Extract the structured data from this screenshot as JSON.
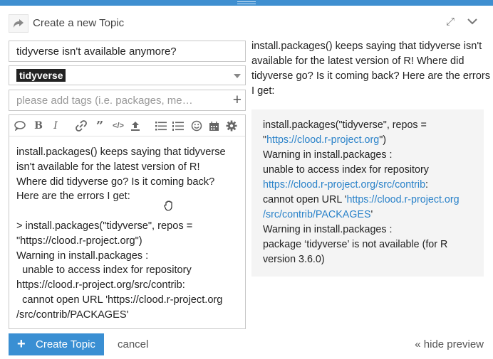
{
  "header": {
    "title": "Create a new Topic",
    "icons": [
      "reply-icon",
      "expand-icon",
      "collapse-chevron-icon"
    ]
  },
  "composer": {
    "title_value": "tidyverse isn't available anymore?",
    "category": "tidyverse",
    "tags_placeholder": "please add tags (i.e. packages, me…",
    "toolbar_icons": [
      "quote-icon",
      "bold-icon",
      "italic-icon",
      "link-icon",
      "blockquote-icon",
      "code-icon",
      "upload-icon",
      "bullet-list-icon",
      "numbered-list-icon",
      "emoji-icon",
      "calendar-icon",
      "gear-icon"
    ],
    "body": "install.packages() keeps saying that tidyverse\nisn't available for the latest version of R!\nWhere did tidyverse go? Is it coming back?\nHere are the errors I get:\n\n> install.packages(\"tidyverse\", repos =\n\"https://clood.r-project.org\")\nWarning in install.packages :\n  unable to access index for repository\nhttps://clood.r-project.org/src/contrib:\n  cannot open URL 'https://clood.r-project.org\n/src/contrib/PACKAGES'"
  },
  "preview": {
    "intro": "install.packages() keeps saying that tidyverse isn't available for the latest version of R! Where did tidyverse go? Is it coming back? Here are the errors I get:",
    "code": {
      "l1": "install.packages(\"tidyverse\", repos =",
      "l2_pre": "\"",
      "l2_link": "https://clood.r-project.org",
      "l2_post": "\")",
      "l3": "Warning in install.packages :",
      "l4": "unable to access index for repository",
      "l5_link": "https://clood.r-project.org/src/contrib",
      "l5_post": ":",
      "l6_pre": "cannot open URL '",
      "l6_link": "https://clood.r-project.org",
      "l7_link": "/src/contrib/PACKAGES",
      "l7_post": "'",
      "l8": "Warning in install.packages :",
      "l9": "package ‘tidyverse’ is not available (for R",
      "l10": "version 3.6.0)"
    }
  },
  "footer": {
    "create_label": "Create Topic",
    "cancel_label": "cancel",
    "hide_preview_label": "« hide preview"
  },
  "colors": {
    "accent": "#3a8fd3",
    "link": "#2a82c9",
    "code_bg": "#f4f4f4"
  }
}
